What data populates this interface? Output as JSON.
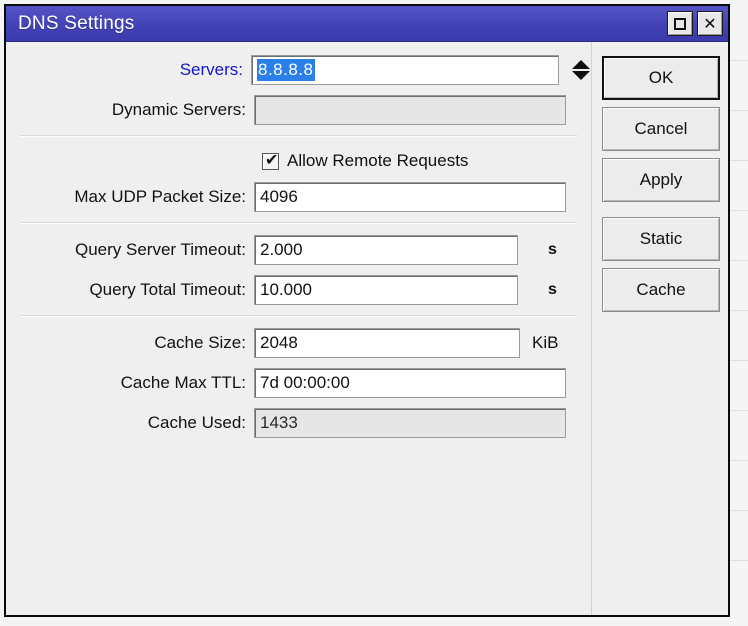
{
  "window": {
    "title": "DNS Settings",
    "titlebar_color": "#4242b4",
    "controls": [
      {
        "name": "maximize",
        "glyph": "maximize-icon"
      },
      {
        "name": "close",
        "glyph": "close-icon",
        "label": "✕"
      }
    ]
  },
  "form": {
    "servers": {
      "label": "Servers:",
      "label_color": "#1414d2",
      "value": "8.8.8.8",
      "selected": true,
      "placeholder": "",
      "spinner": true
    },
    "dynamic_servers": {
      "label": "Dynamic Servers:",
      "value": "",
      "placeholder": "",
      "readonly": true
    },
    "allow_remote_requests": {
      "label": "Allow Remote Requests",
      "checked": true,
      "tick": "✔"
    },
    "max_udp_packet_size": {
      "label": "Max UDP Packet Size:",
      "value": "4096",
      "placeholder": ""
    },
    "query_server_timeout": {
      "label": "Query Server Timeout:",
      "value": "2.000",
      "unit": "s",
      "placeholder": ""
    },
    "query_total_timeout": {
      "label": "Query Total Timeout:",
      "value": "10.000",
      "unit": "s",
      "placeholder": ""
    },
    "cache_size": {
      "label": "Cache Size:",
      "value": "2048",
      "unit": "KiB",
      "placeholder": ""
    },
    "cache_max_ttl": {
      "label": "Cache Max TTL:",
      "value": "7d 00:00:00",
      "placeholder": ""
    },
    "cache_used": {
      "label": "Cache Used:",
      "value": "1433",
      "readonly": true,
      "placeholder": ""
    }
  },
  "buttons": {
    "ok": "OK",
    "cancel": "Cancel",
    "apply": "Apply",
    "static": "Static",
    "cache": "Cache"
  }
}
